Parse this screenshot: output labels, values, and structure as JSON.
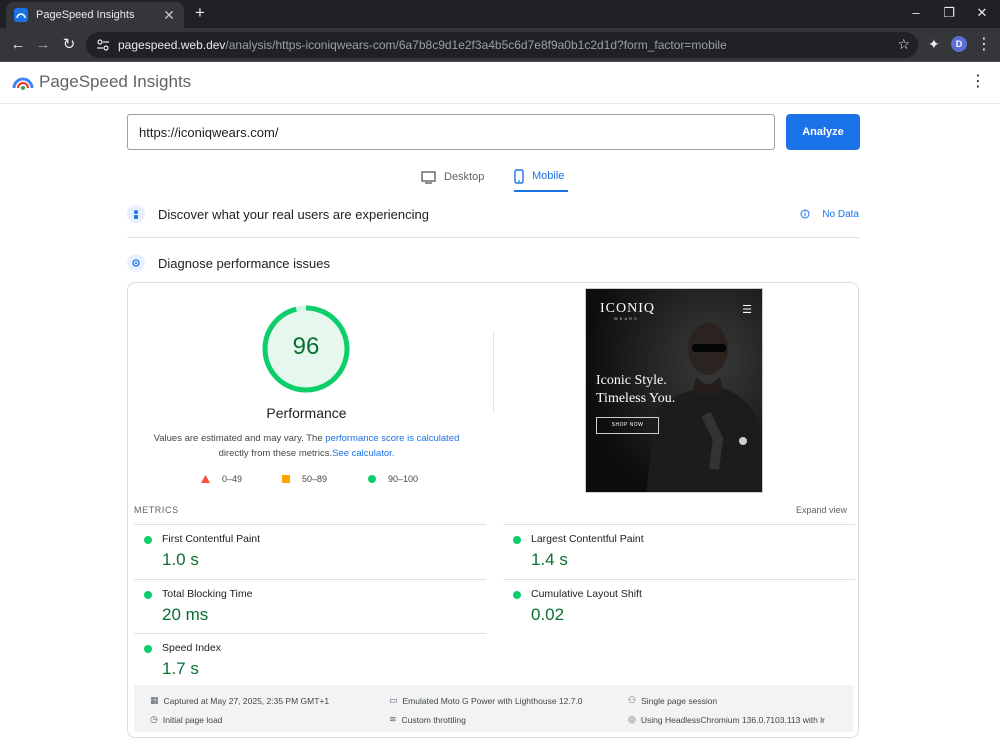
{
  "browser": {
    "tab_title": "PageSpeed Insights",
    "tab_close": "✕",
    "new_tab": "+",
    "url_host": "pagespeed.web.dev",
    "url_path": "/analysis/https-iconiqwears-com/6a7b8c9d1e2f3a4b5c6d7e8f9a0b1c2d1d?form_factor=mobile",
    "profile_initial": "D",
    "window_controls": [
      "–",
      "❐",
      "✕"
    ]
  },
  "app": {
    "title": "PageSpeed Insights",
    "url_input_value": "https://iconiqwears.com/",
    "analyze_label": "Analyze",
    "tabs": [
      {
        "label": "Desktop",
        "active": false
      },
      {
        "label": "Mobile",
        "active": true
      }
    ]
  },
  "sections": {
    "field": {
      "title": "Discover what your real users are experiencing",
      "nodata": "No Data"
    },
    "lab": {
      "title": "Diagnose performance issues"
    }
  },
  "report": {
    "score": "96",
    "score_fraction": 0.96,
    "category": "Performance",
    "note_pre": "Values are estimated and may vary. The ",
    "note_link1": "performance score is calculated",
    "note_mid": " directly from these metrics.",
    "note_link2": "See calculator.",
    "legend": [
      {
        "range": "0–49",
        "color": "#ff4e42",
        "shape": "triangle"
      },
      {
        "range": "50–89",
        "color": "#ffa400",
        "shape": "square"
      },
      {
        "range": "90–100",
        "color": "#0cce6b",
        "shape": "circle"
      }
    ],
    "screenshot": {
      "brand": "ICONIQ",
      "brand_sub": "WEARS",
      "headline_1": "Iconic Style.",
      "headline_2": "Timeless You.",
      "cta": "SHOP NOW"
    },
    "metrics_header": "METRICS",
    "expand_label": "Expand view",
    "metrics": [
      {
        "name": "First Contentful Paint",
        "value": "1.0 s"
      },
      {
        "name": "Largest Contentful Paint",
        "value": "1.4 s"
      },
      {
        "name": "Total Blocking Time",
        "value": "20 ms"
      },
      {
        "name": "Cumulative Layout Shift",
        "value": "0.02"
      },
      {
        "name": "Speed Index",
        "value": "1.7 s"
      }
    ],
    "run_info": [
      {
        "icon": "calendar-icon",
        "text": "Captured at May 27, 2025, 2:35 PM GMT+1"
      },
      {
        "icon": "device-icon",
        "text": "Emulated Moto G Power with Lighthouse 12.7.0"
      },
      {
        "icon": "session-icon",
        "text": "Single page session"
      },
      {
        "icon": "timer-icon",
        "text": "Initial page load"
      },
      {
        "icon": "wifi-icon",
        "text": "Custom throttling"
      },
      {
        "icon": "chrome-icon",
        "text": "Using HeadlessChromium 136.0.7103.113 with lr"
      }
    ]
  },
  "colors": {
    "accent": "#1a73e8",
    "good": "#0cce6b",
    "good_text": "#0c6e33"
  }
}
